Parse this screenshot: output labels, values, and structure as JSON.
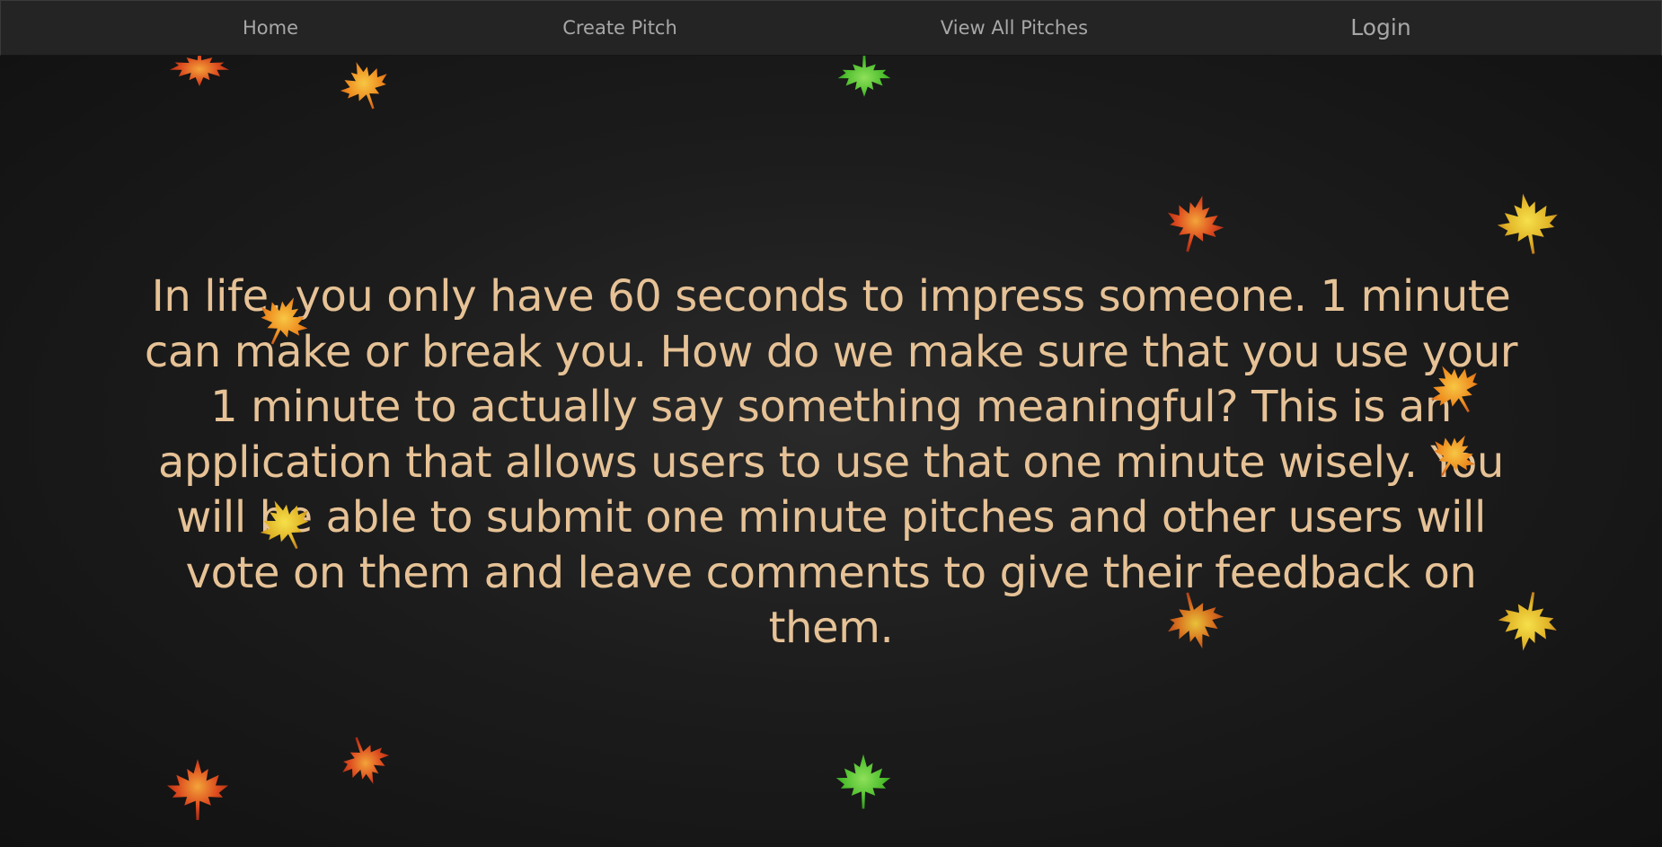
{
  "nav": {
    "home": "Home",
    "create_pitch": "Create Pitch",
    "view_all_pitches": "View All Pitches",
    "login": "Login"
  },
  "intro": {
    "text": "In life, you only have 60 seconds to impress someone. 1 minute can make or break you. How do we make sure that you use your 1 minute to actually say something meaningful? This is an application that allows users to use that one minute wisely. You will be able to submit one minute pitches and other users will vote on them and leave comments to give their feedback on them."
  },
  "colors": {
    "background": "#1c1c1c",
    "navbar": "#242424",
    "nav_text": "#a7a7a7",
    "intro_text": "#e6c296",
    "leaf_red": "#d8431c",
    "leaf_orange": "#ec8a1e",
    "leaf_yellow": "#e2b526",
    "leaf_green": "#4fbf2f"
  },
  "decorations": {
    "leaf_icons": [
      "maple-leaf-icon"
    ]
  }
}
